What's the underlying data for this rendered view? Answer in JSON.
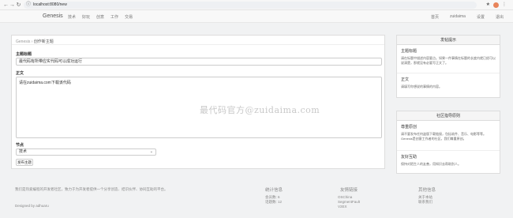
{
  "browser": {
    "url": "localhost:8080/new",
    "nav_back": "←",
    "nav_forward": "→",
    "nav_reload": "↻",
    "info_icon": "ⓘ",
    "toolbar_icons": [
      "★",
      "⋮"
    ]
  },
  "appnav": {
    "brand": "Genesis",
    "links": [
      "技术",
      "好玩",
      "创意",
      "工作",
      "交易"
    ],
    "right": [
      "首页",
      "zuidaima",
      "设置",
      "退出"
    ]
  },
  "main": {
    "breadcrumb_home": "Genesis",
    "breadcrumb_sep": "›",
    "breadcrumb_current": "创作新主题",
    "title_label": "主题标题",
    "title_value": "最代码有所带应实代码可以成功运行",
    "body_label": "正文",
    "body_value": "请在zuidaima.com下载该代码",
    "watermark": "最代码官方@zuidaima.com",
    "node_label": "节点",
    "node_value": "技术",
    "submit_label": "发布主题"
  },
  "sidebar1": {
    "header": "发帖提示",
    "sections": [
      {
        "title": "主题标题",
        "desc": "请在标题中描述内容要点。如果一件事情在标题的长度内就已经可以说清楚，那就没有必要写正文了。"
      },
      {
        "title": "正文",
        "desc": "请填写你想说的事情的内容。"
      }
    ]
  },
  "sidebar2": {
    "header": "社区指导原则",
    "sections": [
      {
        "title": "尊重原创",
        "desc": "请不要发布任何盗版下载链接，包括软件、音乐、电影等等。Genesis是创意工作者的社区，我们尊重原创。"
      },
      {
        "title": "友好互助",
        "desc": "保持对陌生人的友善，用知识去帮助别人。"
      }
    ]
  },
  "footer": {
    "intro": "我们是热爱编程的开发者社区，致力于为开发者提供一个分享创造、结识伙伴、协同互助的平台。",
    "designed": "Designed by adhuaru",
    "stats": {
      "title": "统计信息",
      "items": [
        "会员数: 6",
        "话题数: 12"
      ]
    },
    "links": {
      "title": "友情链接",
      "items": [
        "OSChina",
        "SegmentFault",
        "V2EX"
      ]
    },
    "other": {
      "title": "其他信息",
      "items": [
        "关于本站",
        "联系我们"
      ]
    }
  }
}
